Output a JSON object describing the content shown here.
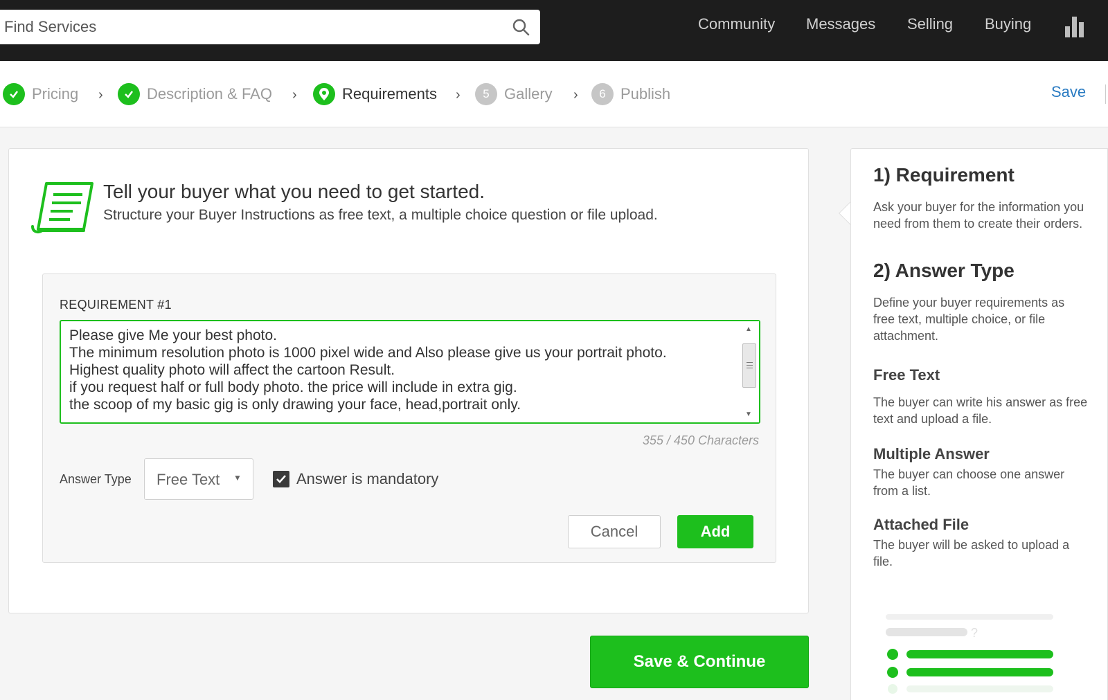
{
  "topbar": {
    "search_placeholder": "Find Services",
    "nav": [
      "Community",
      "Messages",
      "Selling",
      "Buying"
    ]
  },
  "steps": {
    "items": [
      {
        "label": "Pricing",
        "state": "done"
      },
      {
        "label": "Description & FAQ",
        "state": "done"
      },
      {
        "label": "Requirements",
        "state": "current"
      },
      {
        "label": "Gallery",
        "state": "todo",
        "number": "5"
      },
      {
        "label": "Publish",
        "state": "todo",
        "number": "6"
      }
    ],
    "save_label": "Save"
  },
  "card": {
    "title": "Tell your buyer what you need to get started.",
    "subtitle": "Structure your Buyer Instructions as free text, a multiple choice question or file upload.",
    "requirement": {
      "label": "REQUIREMENT #1",
      "text": "Please give Me your best photo.\nThe minimum resolution photo is 1000 pixel wide and Also please give us your portrait photo.\nHighest quality photo will affect the cartoon Result.\nif you request half or full body photo. the price will include in extra gig.\nthe scoop of my basic gig is only drawing your face, head,portrait only.",
      "char_count": "355 / 450 Characters",
      "answer_type_label": "Answer Type",
      "answer_type_value": "Free Text",
      "mandatory_label": "Answer is mandatory",
      "mandatory_checked": true,
      "cancel_label": "Cancel",
      "add_label": "Add"
    },
    "save_continue_label": "Save & Continue"
  },
  "side": {
    "h1": "1) Requirement",
    "p1": "Ask your buyer for the information you need from them to create their orders.",
    "h2": "2) Answer Type",
    "p2": "Define your buyer requirements as free text, multiple choice, or file attachment.",
    "free_title": "Free Text",
    "free_desc": "The buyer can write his answer as free text and upload a file.",
    "multi_title": "Multiple Answer",
    "multi_desc": "The buyer can choose one answer from a list.",
    "file_title": "Attached File",
    "file_desc": "The buyer will be asked to upload a file.",
    "illus_mark": "?"
  },
  "colors": {
    "accent_green": "#1dbf1d",
    "link_blue": "#2a7bc2",
    "topbar_bg": "#1d1d1d"
  }
}
